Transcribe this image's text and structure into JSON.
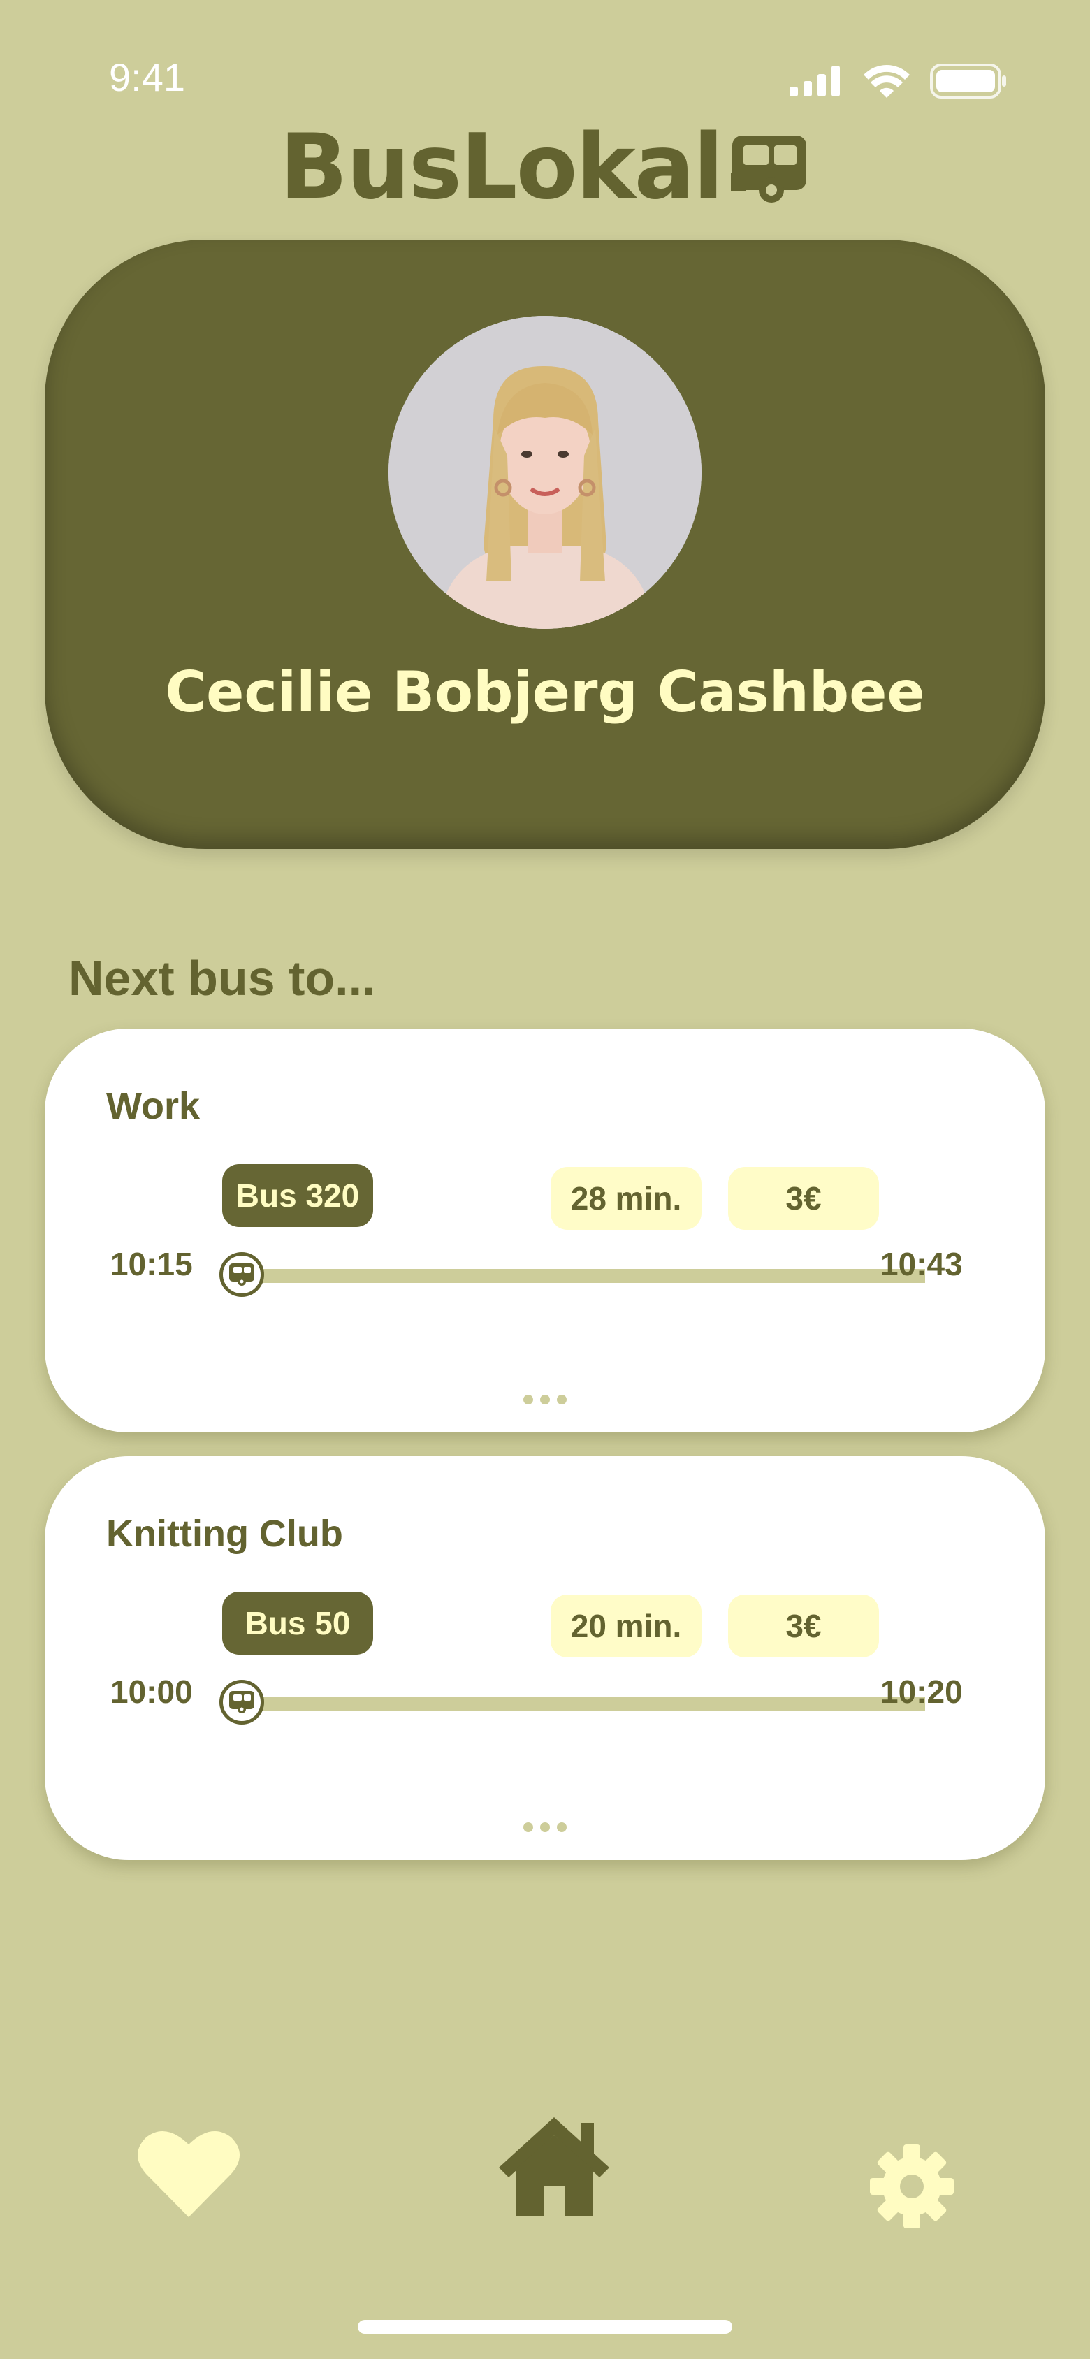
{
  "status_bar": {
    "time": "9:41",
    "icons": [
      "signal-icon",
      "wifi-icon",
      "battery-icon"
    ]
  },
  "header": {
    "logo_text": "BusLokal",
    "logo_icon": "bus-icon"
  },
  "profile": {
    "name": "Cecilie Bobjerg Cashbee",
    "avatar": "avatar-photo"
  },
  "section": {
    "title": "Next bus to..."
  },
  "trips": [
    {
      "destination": "Work",
      "bus": "Bus 320",
      "duration": "28 min.",
      "price": "3€",
      "departure": "10:15",
      "arrival": "10:43"
    },
    {
      "destination": "Knitting Club",
      "bus": "Bus 50",
      "duration": "20 min.",
      "price": "3€",
      "departure": "10:00",
      "arrival": "10:20"
    }
  ],
  "nav": {
    "items": [
      "heart-icon",
      "home-icon",
      "gear-icon"
    ],
    "active": "home-icon"
  },
  "colors": {
    "background": "#cdcd9a",
    "olive": "#666634",
    "olive_text": "#636330",
    "cream": "#fffcc2",
    "card": "#ffffff"
  }
}
